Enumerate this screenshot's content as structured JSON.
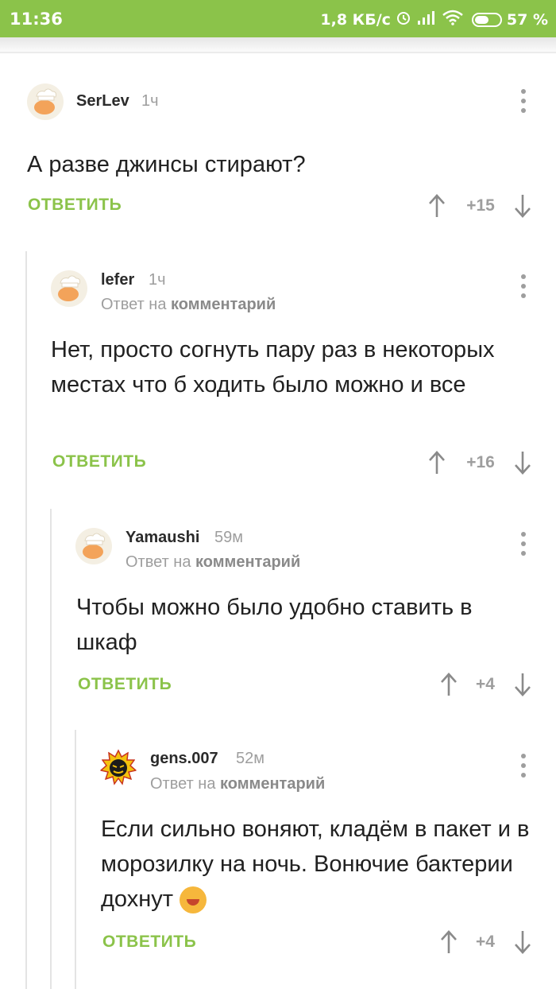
{
  "status_bar": {
    "time": "11:36",
    "speed": "1,8 КБ/с",
    "battery": "57 %",
    "battery_level": 0.57
  },
  "reply_prefix": "Ответ на",
  "reply_target": "комментарий",
  "comments": [
    {
      "author": "SerLev",
      "time": "1ч",
      "text": "А разве джинсы стирают?",
      "reply_label": "ОТВЕТИТЬ",
      "rating": "+15"
    },
    {
      "author": "lefer",
      "time": "1ч",
      "text": "Нет, просто согнуть пару раз в некоторых местах что б ходить было можно и все",
      "reply_label": "ОТВЕТИТЬ",
      "rating": "+16"
    },
    {
      "author": "Yamaushi",
      "time": "59м",
      "text": "Чтобы можно было удобно ставить в шкаф",
      "reply_label": "ОТВЕТИТЬ",
      "rating": "+4"
    },
    {
      "author": "gens.007",
      "time": "52м",
      "text": "Если сильно воняют, кладём в пакет и в морозилку на ночь. Вонючие бактерии дохнут",
      "reply_label": "ОТВЕТИТЬ",
      "rating": "+4"
    }
  ],
  "colors": {
    "accent": "#8bc34a",
    "status_bar": "#8bc34a",
    "muted": "#9e9e9e"
  }
}
